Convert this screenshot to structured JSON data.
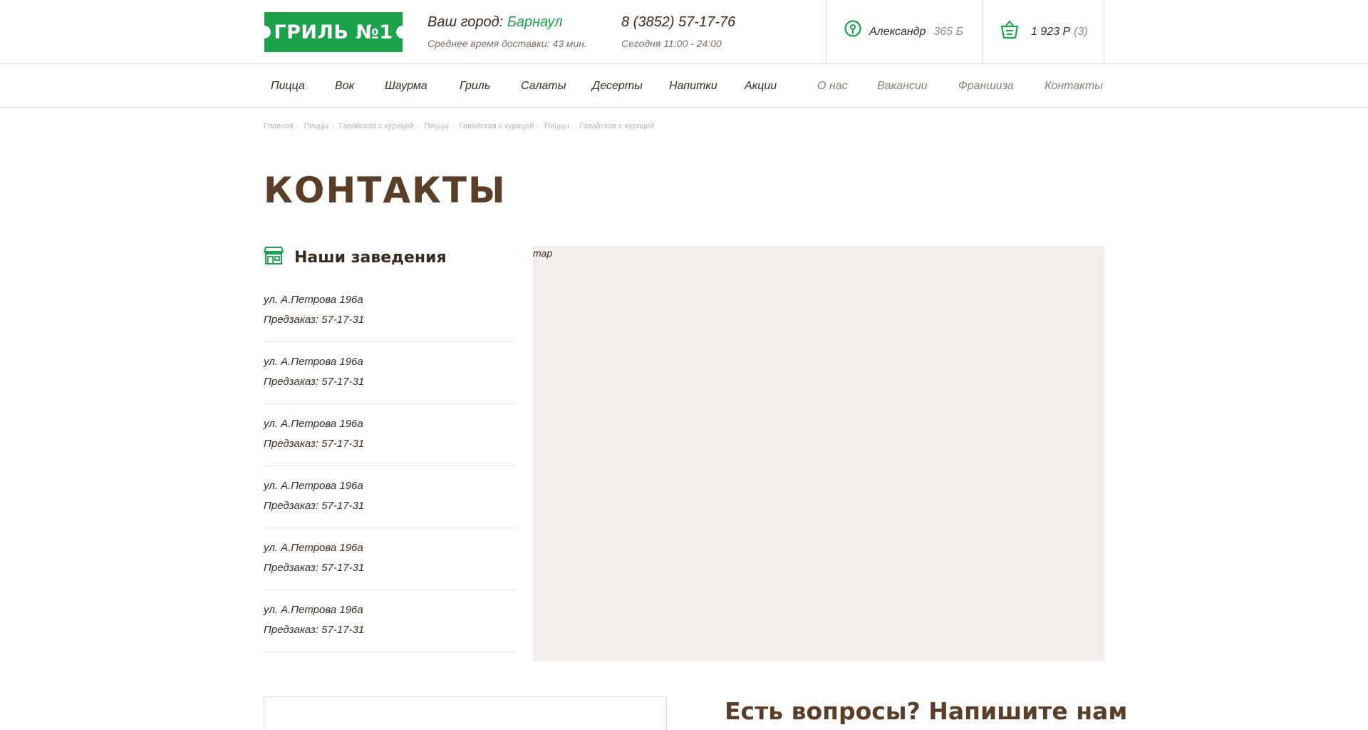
{
  "header": {
    "logo_text": "ГРИЛЬ №1",
    "city_prefix": "Ваш город:",
    "city_name": "Барнаул",
    "delivery_time": "Среднее время доставки: 43 мин.",
    "phone": "8 (3852) 57-17-76",
    "hours": "Сегодня 11:00 - 24:00",
    "user_name": "Александр",
    "user_points": "365 Б",
    "cart_sum": "1 923 Р",
    "cart_count": "(3)"
  },
  "nav": {
    "items": [
      "Пицца",
      "Вок",
      "Шаурма",
      "Гриль",
      "Салаты",
      "Десерты",
      "Напитки",
      "Акции"
    ],
    "secondary": [
      "О нас",
      "Вакансии",
      "Франшиза",
      "Контакты"
    ]
  },
  "breadcrumb": [
    "Главная",
    "Пиццы",
    "Гавайская с курицей",
    "Пиццы",
    "Гавайская с курицей",
    "Пиццы",
    "Гавайская с курицей"
  ],
  "page_title": "КОНТАКТЫ",
  "venues": {
    "title": "Наши заведения",
    "items": [
      {
        "address": "ул. А.Петрова 196а",
        "preorder": "Предзаказ: 57-17-31"
      },
      {
        "address": "ул. А.Петрова 196а",
        "preorder": "Предзаказ: 57-17-31"
      },
      {
        "address": "ул. А.Петрова 196а",
        "preorder": "Предзаказ: 57-17-31"
      },
      {
        "address": "ул. А.Петрова 196а",
        "preorder": "Предзаказ: 57-17-31"
      },
      {
        "address": "ул. А.Петрова 196а",
        "preorder": "Предзаказ: 57-17-31"
      },
      {
        "address": "ул. А.Петрова 196а",
        "preorder": "Предзаказ: 57-17-31"
      }
    ]
  },
  "map_label": "map",
  "contact_title": "Есть вопросы? Напишите нам",
  "colors": {
    "brand_green": "#1aa34a",
    "title_brown": "#5a3e28",
    "text_dark": "#3b2a1e",
    "map_bg": "#f1eeeb"
  },
  "icons": [
    "location-pin-icon",
    "basket-icon",
    "store-icon"
  ]
}
